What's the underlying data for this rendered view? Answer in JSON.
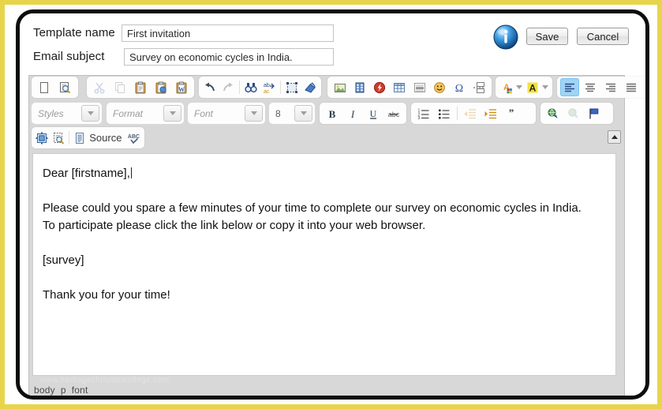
{
  "window": {
    "frame_border_color": "#0d0d0d",
    "outer_border_color": "#e8d44a"
  },
  "form": {
    "template_name_label": "Template name",
    "template_name_value": "First invitation",
    "template_name_placeholder": "",
    "email_subject_label": "Email subject",
    "email_subject_value": "Survey on economic cycles in India.",
    "email_subject_placeholder": "",
    "info_icon": "info-icon",
    "save_label": "Save",
    "cancel_label": "Cancel"
  },
  "editor": {
    "accent_active_color": "#9fd4f6",
    "toolbar_bg": "#d8d8d8",
    "toolbar_rows": [
      {
        "row": 1,
        "groups": [
          {
            "name": "document",
            "buttons": [
              {
                "name": "new-page-icon",
                "glyph": "doc",
                "disabled": false
              },
              {
                "name": "preview-icon",
                "glyph": "preview",
                "disabled": false
              }
            ]
          },
          {
            "name": "clipboard",
            "buttons": [
              {
                "name": "cut-icon",
                "glyph": "scissors",
                "disabled": true
              },
              {
                "name": "copy-icon",
                "glyph": "copy",
                "disabled": true
              },
              {
                "name": "paste-icon",
                "glyph": "paste",
                "disabled": false
              },
              {
                "name": "paste-as-plain-text-icon",
                "glyph": "paste-text",
                "disabled": false
              },
              {
                "name": "paste-from-word-icon",
                "glyph": "paste-word",
                "disabled": false
              }
            ]
          },
          {
            "name": "editing",
            "buttons": [
              {
                "name": "undo-icon",
                "glyph": "undo",
                "disabled": false
              },
              {
                "name": "redo-icon",
                "glyph": "redo",
                "disabled": true
              },
              {
                "name": "separator",
                "glyph": "sep",
                "disabled": false
              },
              {
                "name": "find-icon",
                "glyph": "binoculars",
                "disabled": false
              },
              {
                "name": "replace-icon",
                "glyph": "replace",
                "disabled": false
              },
              {
                "name": "separator",
                "glyph": "sep",
                "disabled": false
              },
              {
                "name": "select-all-icon",
                "glyph": "select-all",
                "disabled": false
              },
              {
                "name": "remove-format-icon",
                "glyph": "eraser",
                "disabled": false
              }
            ]
          },
          {
            "name": "insert",
            "buttons": [
              {
                "name": "image-icon",
                "glyph": "image",
                "disabled": false
              },
              {
                "name": "flash-icon",
                "glyph": "film",
                "disabled": false
              },
              {
                "name": "flash-object-icon",
                "glyph": "flash",
                "disabled": false
              },
              {
                "name": "table-icon",
                "glyph": "table",
                "disabled": false
              },
              {
                "name": "horizontal-rule-icon",
                "glyph": "hrule",
                "disabled": false
              },
              {
                "name": "smiley-icon",
                "glyph": "smiley",
                "disabled": false
              },
              {
                "name": "special-character-icon",
                "glyph": "omega",
                "disabled": false
              },
              {
                "name": "page-break-icon",
                "glyph": "pagebreak",
                "disabled": false
              }
            ]
          },
          {
            "name": "colors",
            "buttons": [
              {
                "name": "text-color-icon",
                "glyph": "text-color",
                "disabled": false
              },
              {
                "name": "text-color-dropdown-icon",
                "glyph": "caret",
                "disabled": false
              },
              {
                "name": "background-color-icon",
                "glyph": "bg-color",
                "disabled": false
              },
              {
                "name": "background-color-dropdown-icon",
                "glyph": "caret",
                "disabled": false
              }
            ]
          },
          {
            "name": "paragraph-align",
            "buttons": [
              {
                "name": "align-left-icon",
                "glyph": "align-left",
                "disabled": false,
                "active": true
              },
              {
                "name": "align-center-icon",
                "glyph": "align-center",
                "disabled": false
              },
              {
                "name": "align-right-icon",
                "glyph": "align-right",
                "disabled": false
              },
              {
                "name": "align-justify-icon",
                "glyph": "align-justify",
                "disabled": false
              }
            ]
          }
        ]
      },
      {
        "row": 2,
        "combos": [
          {
            "name": "styles-dropdown",
            "label": "Styles",
            "italic": true
          },
          {
            "name": "format-dropdown",
            "label": "Format",
            "italic": true
          },
          {
            "name": "font-dropdown",
            "label": "Font",
            "italic": true
          },
          {
            "name": "font-size-dropdown",
            "label": "8",
            "italic": false
          }
        ],
        "groups": [
          {
            "name": "basic-styles",
            "buttons": [
              {
                "name": "bold-icon",
                "glyph": "B",
                "disabled": false
              },
              {
                "name": "italic-icon",
                "glyph": "I",
                "disabled": false
              },
              {
                "name": "underline-icon",
                "glyph": "U",
                "disabled": false
              },
              {
                "name": "strikethrough-icon",
                "glyph": "abc",
                "disabled": false
              }
            ]
          },
          {
            "name": "lists-indent",
            "buttons": [
              {
                "name": "numbered-list-icon",
                "glyph": "ol",
                "disabled": false
              },
              {
                "name": "bulleted-list-icon",
                "glyph": "ul",
                "disabled": false
              },
              {
                "name": "separator",
                "glyph": "sep",
                "disabled": false
              },
              {
                "name": "decrease-indent-icon",
                "glyph": "outdent",
                "disabled": true
              },
              {
                "name": "increase-indent-icon",
                "glyph": "indent",
                "disabled": false
              },
              {
                "name": "block-quote-icon",
                "glyph": "quote",
                "disabled": false
              }
            ]
          },
          {
            "name": "links",
            "buttons": [
              {
                "name": "link-icon",
                "glyph": "link",
                "disabled": false
              },
              {
                "name": "unlink-icon",
                "glyph": "unlink",
                "disabled": true
              },
              {
                "name": "anchor-icon",
                "glyph": "anchor-flag",
                "disabled": false
              }
            ]
          }
        ]
      },
      {
        "row": 3,
        "groups": [
          {
            "name": "tools",
            "buttons": [
              {
                "name": "maximize-icon",
                "glyph": "maximize",
                "disabled": false
              },
              {
                "name": "show-blocks-icon",
                "glyph": "show-blocks",
                "disabled": false
              },
              {
                "name": "separator",
                "glyph": "sep",
                "disabled": false
              },
              {
                "name": "source-icon",
                "glyph": "source",
                "disabled": false
              },
              {
                "name": "spell-check-icon",
                "glyph": "abc-check",
                "disabled": false
              }
            ]
          },
          {
            "name": "source-label",
            "label": "Source"
          }
        ]
      }
    ],
    "collapse_toolbar_icon": "collapse-toolbar-icon",
    "body_paragraphs": [
      "Dear [firstname],",
      "",
      "Please could you spare a few minutes of your time to complete our survey on economic cycles in India.",
      "To participate please click the link below or copy it into your web browser.",
      "",
      "[survey]",
      "",
      "Thank you for your time!"
    ],
    "status_path": [
      "body",
      "p",
      "font"
    ],
    "watermark": "www.heritagechristiancollege.com"
  }
}
